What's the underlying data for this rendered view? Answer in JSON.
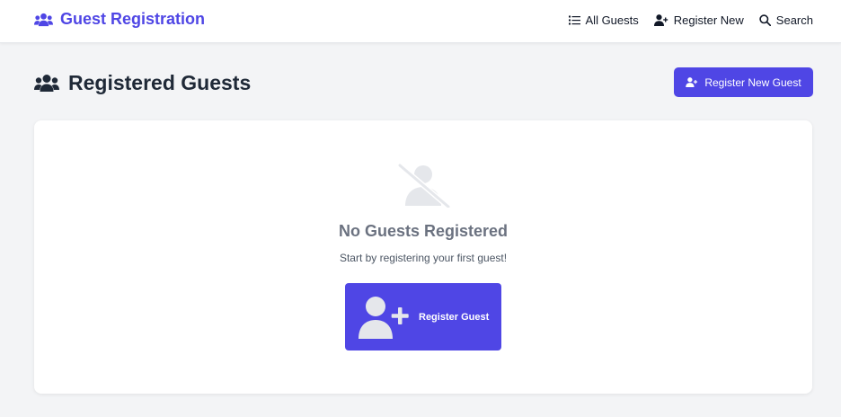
{
  "navbar": {
    "brand": "Guest Registration",
    "links": [
      {
        "label": "All Guests",
        "icon": "list-icon"
      },
      {
        "label": "Register New",
        "icon": "user-plus-icon"
      },
      {
        "label": "Search",
        "icon": "search-icon"
      }
    ]
  },
  "page": {
    "title": "Registered Guests",
    "title_icon": "users-icon",
    "register_button_label": "Register New Guest"
  },
  "empty_state": {
    "icon": "user-slash-icon",
    "title": "No Guests Registered",
    "message": "Start by registering your first guest!",
    "button_label": "Register Guest"
  },
  "colors": {
    "accent": "#4f46e5",
    "background": "#f3f4f6",
    "card": "#ffffff",
    "muted_text": "#6b7280"
  }
}
